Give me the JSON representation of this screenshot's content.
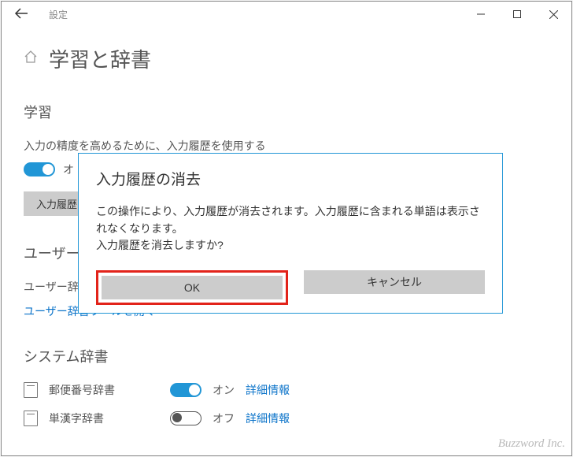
{
  "titlebar": {
    "label": "設定"
  },
  "page": {
    "title": "学習と辞書"
  },
  "learning": {
    "heading": "学習",
    "desc": "入力の精度を高めるために、入力履歴を使用する",
    "toggle_label": "オ",
    "clear_button": "入力履歴"
  },
  "user_dict": {
    "heading": "ユーザー辞",
    "desc": "ユーザー辞書集を行う",
    "link": "ユーザー辞書ツールを開く"
  },
  "system_dict": {
    "heading": "システム辞書",
    "items": [
      {
        "name": "郵便番号辞書",
        "state_label": "オン",
        "on": true,
        "detail": "詳細情報"
      },
      {
        "name": "単漢字辞書",
        "state_label": "オフ",
        "on": false,
        "detail": "詳細情報"
      }
    ]
  },
  "dialog": {
    "title": "入力履歴の消去",
    "body_line1": "この操作により、入力履歴が消去されます。入力履歴に含まれる単語は表示されなくなります。",
    "body_line2": "入力履歴を消去しますか?",
    "ok": "OK",
    "cancel": "キャンセル"
  },
  "watermark": "Buzzword Inc."
}
